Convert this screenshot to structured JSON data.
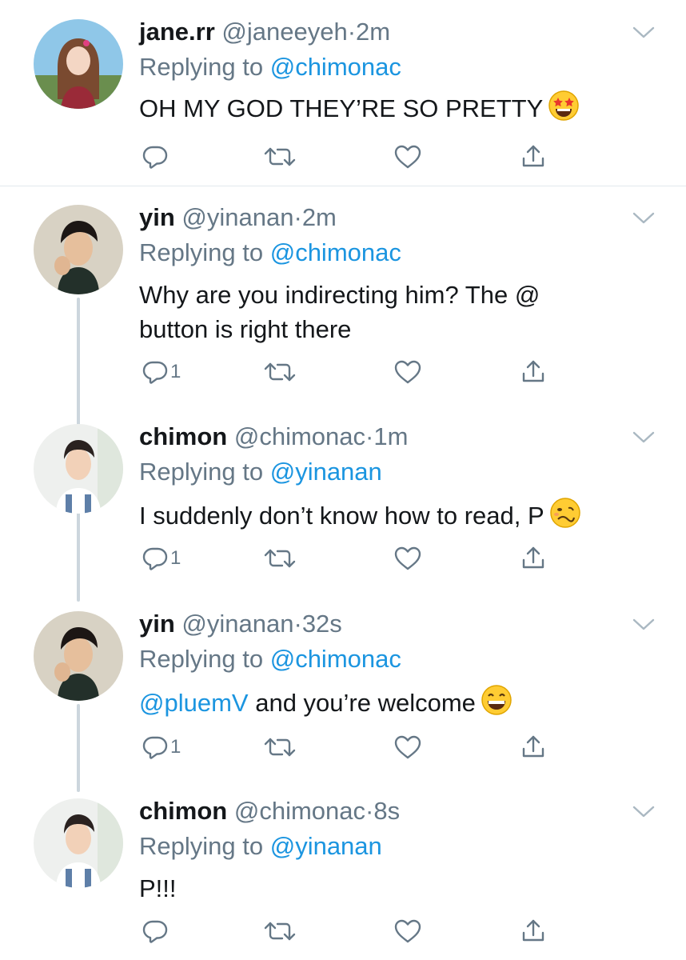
{
  "colors": {
    "link": "#1b95e0",
    "secondary": "#657786",
    "text": "#14171a",
    "divider": "#e1e8ed",
    "thread": "#ccd6dd"
  },
  "tweets": [
    {
      "name": "jane.rr",
      "handle": "@janeeyeh",
      "dot": "·",
      "time": "2m",
      "replying_prefix": "Replying to",
      "replying_to": "@chimonac",
      "text": "OH MY GOD THEY’RE SO PRETTY",
      "emoji": "star-struck-emoji",
      "reply_count": ""
    },
    {
      "name": "yin",
      "handle": "@yinanan",
      "dot": "·",
      "time": "2m",
      "replying_prefix": "Replying to",
      "replying_to": "@chimonac",
      "text_line1": "Why are you indirecting him? The @",
      "text_line2": "button is right there",
      "reply_count": "1"
    },
    {
      "name": "chimon",
      "handle": "@chimonac",
      "dot": "·",
      "time": "1m",
      "replying_prefix": "Replying to",
      "replying_to": "@yinanan",
      "text": "I suddenly don’t know how to read, P",
      "emoji": "woozy-face-emoji",
      "reply_count": "1"
    },
    {
      "name": "yin",
      "handle": "@yinanan",
      "dot": "·",
      "time": "32s",
      "replying_prefix": "Replying to",
      "replying_to": "@chimonac",
      "text_mention": "@pluemV",
      "text": " and you’re welcome",
      "emoji": "grinning-face-emoji",
      "reply_count": "1"
    },
    {
      "name": "chimon",
      "handle": "@chimonac",
      "dot": "·",
      "time": "8s",
      "replying_prefix": "Replying to",
      "replying_to": "@yinanan",
      "text": "P!!!",
      "reply_count": ""
    }
  ],
  "icons": {
    "reply": "reply-icon",
    "retweet": "retweet-icon",
    "like": "heart-icon",
    "share": "share-icon",
    "caret": "chevron-down-icon"
  }
}
